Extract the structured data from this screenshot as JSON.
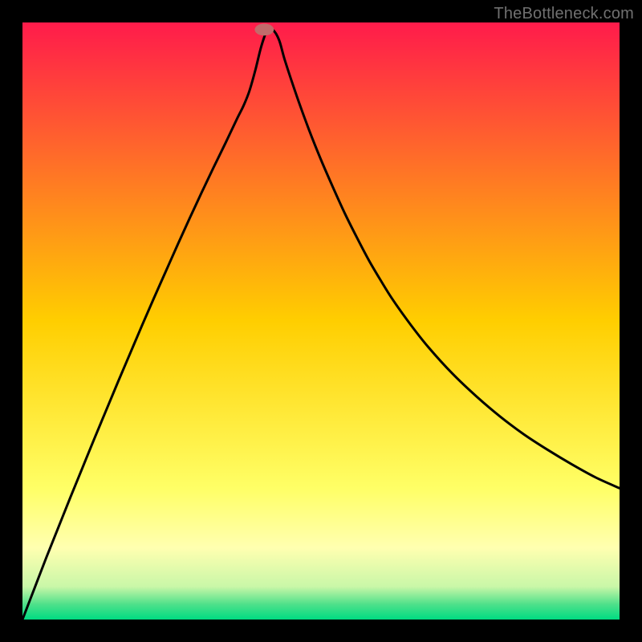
{
  "watermark": "TheBottleneck.com",
  "chart_data": {
    "type": "line",
    "title": "",
    "xlabel": "",
    "ylabel": "",
    "xlim": [
      0,
      100
    ],
    "ylim": [
      0,
      100
    ],
    "grid": false,
    "legend": false,
    "background_gradient": {
      "stops": [
        {
          "offset": 0.0,
          "color": "#ff1b4b"
        },
        {
          "offset": 0.5,
          "color": "#ffce00"
        },
        {
          "offset": 0.78,
          "color": "#ffff66"
        },
        {
          "offset": 0.88,
          "color": "#ffffb0"
        },
        {
          "offset": 0.945,
          "color": "#c9f7a8"
        },
        {
          "offset": 0.975,
          "color": "#4de08a"
        },
        {
          "offset": 1.0,
          "color": "#00dc82"
        }
      ]
    },
    "marker": {
      "x": 40.5,
      "y": 98.8,
      "color": "#c26b6b",
      "rx": 1.6,
      "ry": 1.0
    },
    "series": [
      {
        "name": "bottleneck-curve",
        "color": "#000000",
        "x": [
          0,
          2,
          4,
          6,
          8,
          10,
          12,
          14,
          16,
          18,
          20,
          22,
          24,
          26,
          28,
          30,
          32,
          34,
          36,
          37,
          38,
          39,
          40,
          41,
          42,
          43,
          44,
          46,
          48,
          50,
          52,
          54,
          56,
          58,
          60,
          62,
          65,
          68,
          72,
          76,
          80,
          84,
          88,
          92,
          96,
          100
        ],
        "y": [
          0,
          5.2,
          10.4,
          15.4,
          20.4,
          25.3,
          30.2,
          35.0,
          39.8,
          44.5,
          49.2,
          53.8,
          58.3,
          62.8,
          67.2,
          71.5,
          75.7,
          79.8,
          84.0,
          86.0,
          88.5,
          92.0,
          96.0,
          98.7,
          98.7,
          97.0,
          93.5,
          87.5,
          82.0,
          77.0,
          72.4,
          68.0,
          64.0,
          60.2,
          56.8,
          53.6,
          49.4,
          45.6,
          41.2,
          37.4,
          34.0,
          31.0,
          28.4,
          26.0,
          23.8,
          22.0
        ]
      }
    ]
  }
}
